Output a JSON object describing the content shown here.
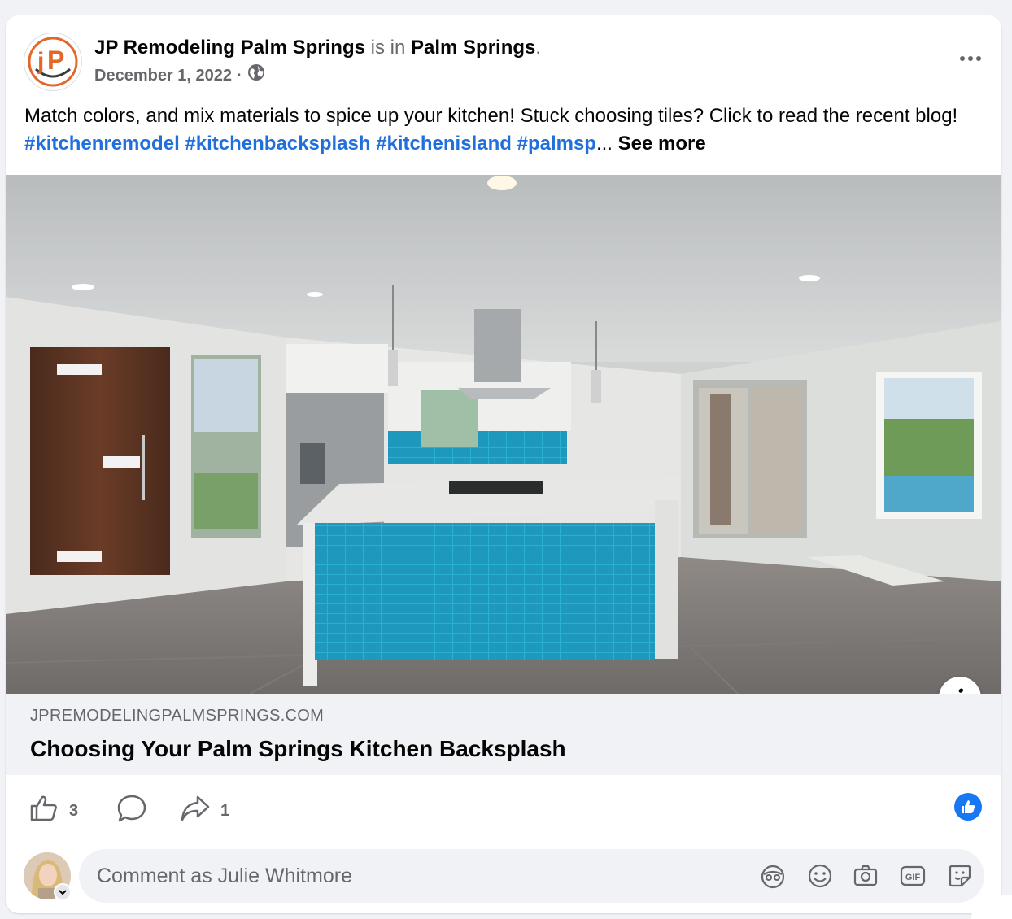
{
  "post": {
    "author": "JP Remodeling Palm Springs",
    "is_in": "is in",
    "place": "Palm Springs",
    "period": ".",
    "date": "December 1, 2022",
    "dot": "·",
    "caption_text": "Match colors, and mix materials to spice up your kitchen! Stuck choosing tiles? Click to read the recent blog! ",
    "hashtags": [
      "#kitchenremodel",
      "#kitchenbacksplash",
      "#kitchenisland",
      "#palmsp"
    ],
    "ellipsis": "...",
    "see_more": "See more",
    "avatar_initials": "jP"
  },
  "link": {
    "domain": "JPREMODELINGPALMSPRINGS.COM",
    "title": "Choosing Your Palm Springs Kitchen Backsplash",
    "info_glyph": "i"
  },
  "actions": {
    "like_count": "3",
    "share_count": "1",
    "icons": [
      "thumbs-up-icon",
      "comment-bubble-icon",
      "share-arrow-icon",
      "like-reaction-icon"
    ]
  },
  "comment": {
    "placeholder": "Comment as Julie Whitmore",
    "tools": [
      "avatar-sticker-icon",
      "emoji-icon",
      "camera-icon",
      "gif-icon",
      "sticker-icon"
    ],
    "gif_label": "GIF"
  },
  "colors": {
    "link_blue": "#216fdb",
    "brand_orange": "#e4672a",
    "like_blue": "#1877f2",
    "tile_blue": "#1f98bd"
  }
}
